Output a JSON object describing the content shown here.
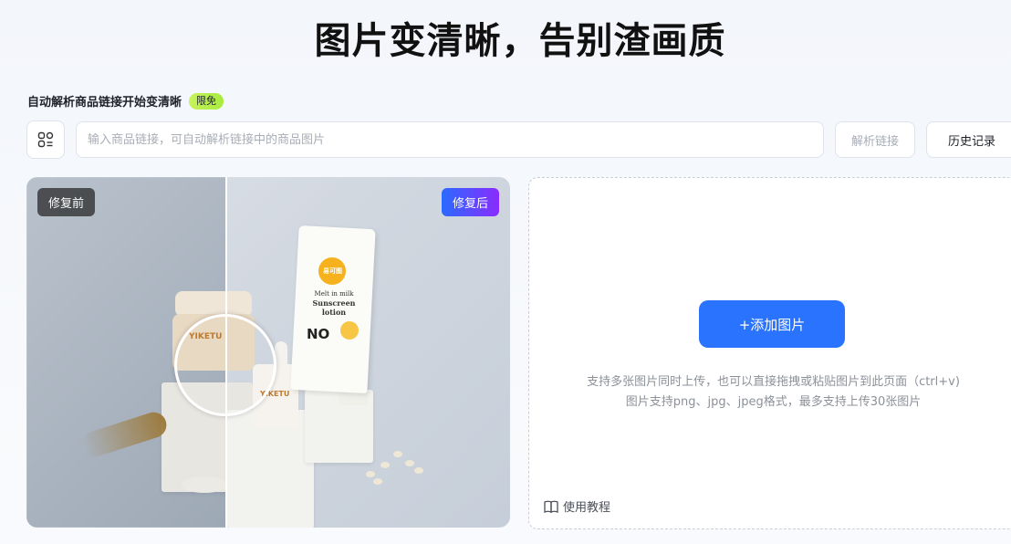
{
  "header": {
    "title": "图片变清晰，告别渣画质",
    "subtitle": "自动解析商品链接开始变清晰",
    "badge": "限免"
  },
  "link_bar": {
    "placeholder": "输入商品链接，可自动解析链接中的商品图片",
    "parse_label": "解析链接",
    "history_label": "历史记录"
  },
  "demo": {
    "before_label": "修复前",
    "after_label": "修复后",
    "tube_brand": "易可图",
    "tube_line1": "Melt in milk",
    "tube_line2": "Sunscreen lotion",
    "jar_brand": "YIKETU",
    "bottle_brand": "YIKETU"
  },
  "upload": {
    "add_label": "+添加图片",
    "hint_line1": "支持多张图片同时上传，也可以直接拖拽或粘贴图片到此页面（ctrl+v)",
    "hint_line2": "图片支持png、jpg、jpeg格式，最多支持上传30张图片",
    "tutorial_label": "使用教程"
  },
  "colors": {
    "primary": "#2a73ff",
    "badge": "#b8f04a"
  }
}
